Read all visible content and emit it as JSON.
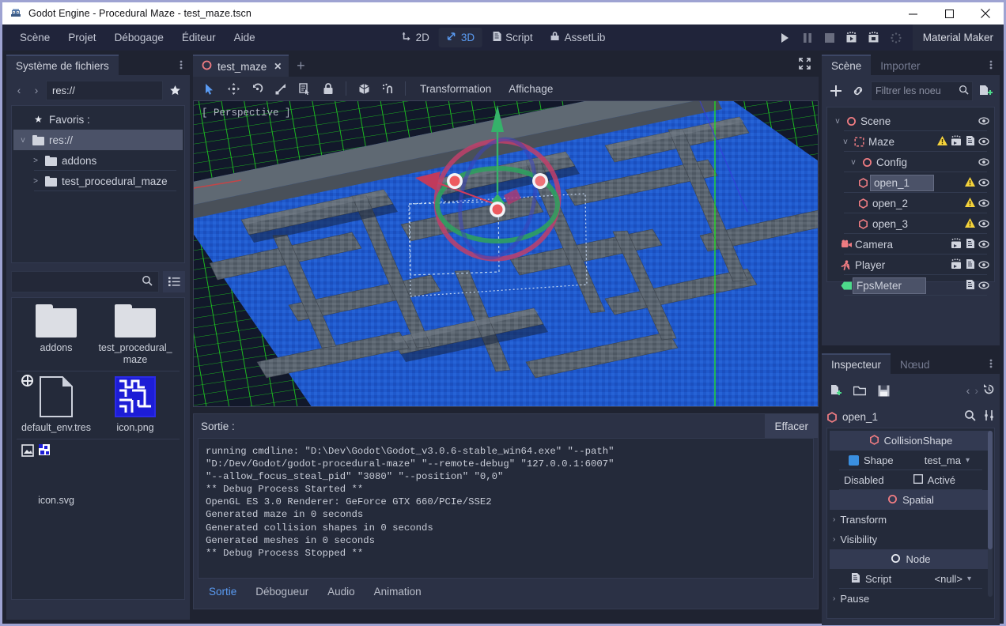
{
  "window": {
    "title": "Godot Engine - Procedural Maze - test_maze.tscn",
    "icon": "godot-robot-icon",
    "minimize": "−",
    "maximize": "□",
    "close": "✕"
  },
  "menubar": {
    "items": [
      "Scène",
      "Projet",
      "Débogage",
      "Éditeur",
      "Aide"
    ],
    "modes": [
      {
        "label": "2D",
        "icon": "move-2d-icon",
        "active": false
      },
      {
        "label": "3D",
        "icon": "move-3d-icon",
        "active": true
      },
      {
        "label": "Script",
        "icon": "script-icon",
        "active": false
      },
      {
        "label": "AssetLib",
        "icon": "assetlib-icon",
        "active": false
      }
    ],
    "play_tools": [
      {
        "name": "play-scene-button",
        "icon": "play-icon"
      },
      {
        "name": "pause-button",
        "icon": "pause-icon"
      },
      {
        "name": "stop-button",
        "icon": "stop-icon"
      },
      {
        "name": "play-current-scene-button",
        "icon": "play-scene-icon"
      },
      {
        "name": "play-custom-scene-button",
        "icon": "play-custom-icon"
      },
      {
        "name": "progress-spinner",
        "icon": "spinner-icon"
      }
    ],
    "material_maker": "Material Maker"
  },
  "filesystem": {
    "tab": "Système de fichiers",
    "tab_menu_icon": "vertical-dots-icon",
    "path_value": "res://",
    "nav_back": "‹",
    "nav_forward": "›",
    "favorite_icon": "star-icon",
    "tree": [
      {
        "label": "Favoris :",
        "icon": "star-icon",
        "indent": 0,
        "caret": "",
        "selected": false
      },
      {
        "label": "res://",
        "icon": "folder-icon",
        "indent": 0,
        "caret": "v",
        "selected": true
      },
      {
        "label": "addons",
        "icon": "folder-icon",
        "indent": 1,
        "caret": ">",
        "selected": false
      },
      {
        "label": "test_procedural_maze",
        "icon": "folder-icon",
        "indent": 1,
        "caret": ">",
        "selected": false
      }
    ],
    "search_placeholder": "",
    "search_icon": "search-icon",
    "list_mode_icon": "list-view-icon",
    "files_row1": [
      {
        "name": "addons",
        "icon": "folder-icon"
      },
      {
        "name": "test_procedural_maze",
        "icon": "folder-icon"
      }
    ],
    "files_row2": [
      {
        "name": "default_env.tres",
        "icon": "resource-file-icon",
        "badge": "globe-icon"
      },
      {
        "name": "icon.png",
        "icon": "maze-image-thumbnail",
        "badge": "image-badge-icon"
      }
    ],
    "files_row3": [
      {
        "name": "icon.svg",
        "icon": "svg-file-icon",
        "badge": "image-badge-icon"
      }
    ]
  },
  "scene_tabs": {
    "tabs": [
      {
        "label": "test_maze",
        "icon": "scene-node-icon",
        "close": "✕"
      }
    ],
    "add": "+"
  },
  "viewport": {
    "expand_icon": "fullscreen-icon",
    "tools": [
      {
        "name": "select-mode-tool",
        "icon": "cursor-arrow-icon",
        "selected": true
      },
      {
        "name": "move-mode-tool",
        "icon": "move-icon",
        "selected": false
      },
      {
        "name": "rotate-mode-tool",
        "icon": "rotate-icon",
        "selected": false
      },
      {
        "name": "scale-mode-tool",
        "icon": "scale-icon",
        "selected": false
      },
      {
        "name": "list-select-tool",
        "icon": "list-select-icon",
        "selected": false
      },
      {
        "name": "lock-tool",
        "icon": "lock-icon",
        "selected": false
      },
      {
        "name": "local-space-tool",
        "icon": "cube-icon",
        "selected": false
      },
      {
        "name": "snap-tool",
        "icon": "snap-icon",
        "selected": false
      }
    ],
    "menus": [
      "Transformation",
      "Affichage"
    ],
    "perspective_label": "[ Perspective ]"
  },
  "output": {
    "title": "Sortie :",
    "clear_label": "Effacer",
    "lines": [
      "running cmdline: \"D:\\Dev\\Godot\\Godot_v3.0.6-stable_win64.exe\" \"--path\"",
      "\"D:/Dev/Godot/godot-procedural-maze\" \"--remote-debug\" \"127.0.0.1:6007\"",
      "\"--allow_focus_steal_pid\" \"3080\" \"--position\" \"0,0\"",
      "** Debug Process Started **",
      "OpenGL ES 3.0 Renderer: GeForce GTX 660/PCIe/SSE2",
      "Generated maze in 0 seconds",
      "Generated collision shapes in 0 seconds",
      "Generated meshes in 0 seconds",
      "** Debug Process Stopped **"
    ],
    "tabs": [
      {
        "label": "Sortie",
        "active": true
      },
      {
        "label": "Débogueur",
        "active": false
      },
      {
        "label": "Audio",
        "active": false
      },
      {
        "label": "Animation",
        "active": false
      }
    ]
  },
  "scene_dock": {
    "tabs": [
      {
        "label": "Scène",
        "active": true
      },
      {
        "label": "Importer",
        "active": false
      }
    ],
    "menu_icon": "vertical-dots-icon",
    "add_node_icon": "plus-icon",
    "link_icon": "link-icon",
    "filter_placeholder": "Filtrer les noeu",
    "filter_search_icon": "search-icon",
    "new_scene_icon": "create-script-icon",
    "nodes": [
      {
        "label": "Scene",
        "icon": "node-icon",
        "indent": 0,
        "caret": "v",
        "selected": false,
        "warning": false,
        "anim": false,
        "script": false,
        "eye": true
      },
      {
        "label": "Maze",
        "icon": "spatial-icon",
        "indent": 1,
        "caret": "v",
        "selected": false,
        "warning": true,
        "anim": true,
        "script": true,
        "eye": true
      },
      {
        "label": "Config",
        "icon": "node-icon",
        "indent": 2,
        "caret": "v",
        "selected": false,
        "warning": false,
        "anim": false,
        "script": false,
        "eye": true
      },
      {
        "label": "open_1",
        "icon": "collision-icon",
        "indent": 3,
        "caret": "",
        "selected": true,
        "warning": true,
        "anim": false,
        "script": false,
        "eye": true
      },
      {
        "label": "open_2",
        "icon": "collision-icon",
        "indent": 3,
        "caret": "",
        "selected": false,
        "warning": true,
        "anim": false,
        "script": false,
        "eye": true
      },
      {
        "label": "open_3",
        "icon": "collision-icon",
        "indent": 3,
        "caret": "",
        "selected": false,
        "warning": true,
        "anim": false,
        "script": false,
        "eye": true
      },
      {
        "label": "Camera",
        "icon": "camera-icon",
        "indent": 1,
        "caret": "",
        "selected": false,
        "warning": false,
        "anim": true,
        "script": true,
        "eye": true
      },
      {
        "label": "Player",
        "icon": "player-icon",
        "indent": 1,
        "caret": "",
        "selected": false,
        "warning": false,
        "anim": true,
        "script": true,
        "eye": true
      },
      {
        "label": "FpsMeter",
        "icon": "label-icon",
        "indent": 1,
        "caret": "",
        "selected": true,
        "warning": false,
        "anim": false,
        "script": true,
        "eye": true
      }
    ]
  },
  "inspector": {
    "tabs": [
      {
        "label": "Inspecteur",
        "active": true
      },
      {
        "label": "Nœud",
        "active": false
      }
    ],
    "menu_icon": "vertical-dots-icon",
    "toolbar": [
      {
        "name": "new-resource-button",
        "icon": "new-resource-icon"
      },
      {
        "name": "open-resource-button",
        "icon": "folder-open-icon"
      },
      {
        "name": "save-resource-button",
        "icon": "save-icon"
      }
    ],
    "nav_prev": "‹",
    "nav_next": "›",
    "history_icon": "history-icon",
    "object_name": "open_1",
    "object_icon": "collision-icon",
    "search_icon": "search-icon",
    "settings_icon": "tools-icon",
    "rows": [
      {
        "type": "category",
        "label": "CollisionShape",
        "icon": "collision-icon"
      },
      {
        "type": "prop",
        "label": "Shape",
        "icon": "cube-icon",
        "value": "test_ma",
        "control": "dropdown"
      },
      {
        "type": "prop",
        "label": "Disabled",
        "icon": "",
        "value": "Activé",
        "control": "checkbox"
      },
      {
        "type": "category",
        "label": "Spatial",
        "icon": "node-icon"
      },
      {
        "type": "fold",
        "label": "Transform",
        "caret": "›"
      },
      {
        "type": "fold",
        "label": "Visibility",
        "caret": "›"
      },
      {
        "type": "category",
        "label": "Node",
        "icon": "node-white-icon"
      },
      {
        "type": "prop",
        "label": "Script",
        "icon": "script-icon",
        "value": "<null>",
        "control": "dropdown"
      },
      {
        "type": "fold",
        "label": "Pause",
        "caret": "›"
      }
    ]
  },
  "colors": {
    "accent": "#5a9bf2",
    "panel": "#2b3145",
    "panel_dark": "#242a3a",
    "menubar": "#20243a",
    "selection": "#4b5268",
    "warning": "#f5d33c",
    "node_red": "#ef7c82",
    "maze_floor": "#1e58cc",
    "maze_wall": "#555f6b",
    "grid_green": "#22dd22"
  }
}
